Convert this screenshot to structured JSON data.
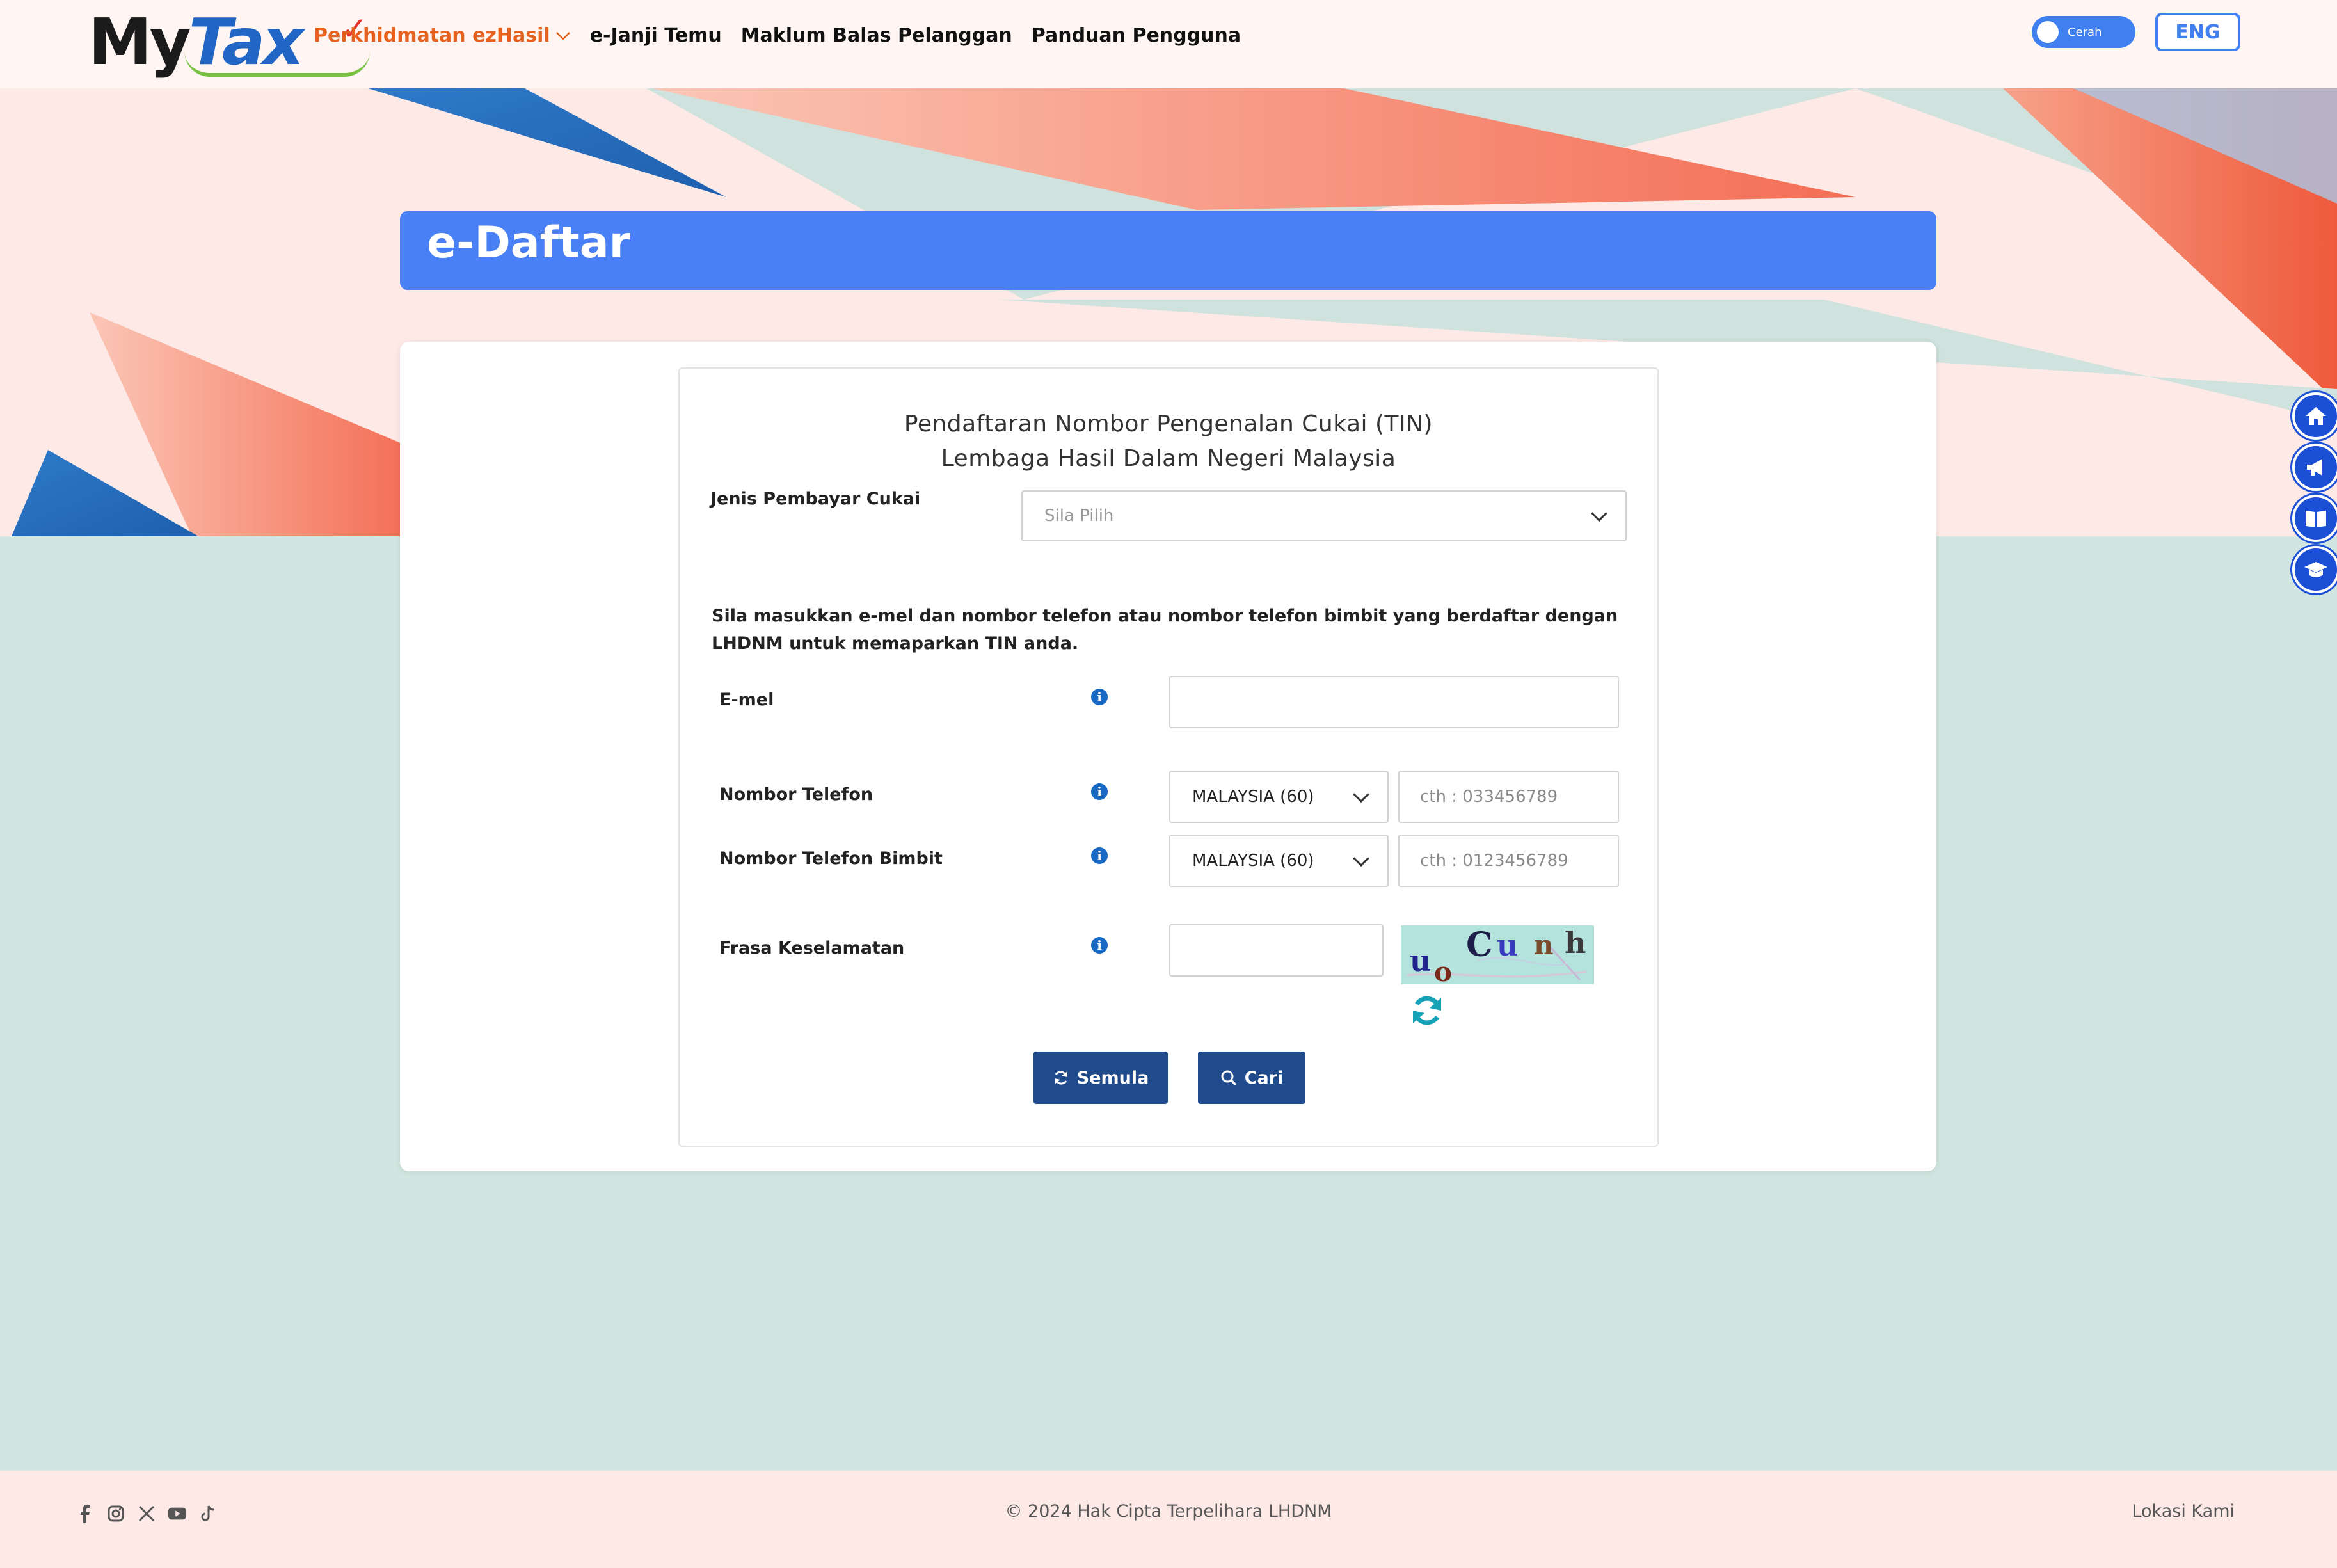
{
  "header": {
    "logo_my": "My",
    "logo_tax": "Tax",
    "nav": [
      {
        "label": "Perkhidmatan ezHasil",
        "active": true
      },
      {
        "label": "e-Janji Temu"
      },
      {
        "label": "Maklum Balas Pelanggan"
      },
      {
        "label": "Panduan Pengguna"
      }
    ],
    "theme_toggle_label": "Cerah",
    "language_button": "ENG"
  },
  "page": {
    "title": "e-Daftar"
  },
  "form": {
    "title_line1": "Pendaftaran Nombor Pengenalan Cukai (TIN)",
    "title_line2": "Lembaga Hasil Dalam Negeri Malaysia",
    "taxpayer_type_label": "Jenis Pembayar Cukai",
    "taxpayer_type_placeholder": "Sila Pilih",
    "instruction": "Sila masukkan e-mel dan nombor telefon atau nombor telefon bimbit yang berdaftar dengan LHDNM untuk memaparkan TIN anda.",
    "email_label": "E-mel",
    "email_value": "",
    "phone_label": "Nombor Telefon",
    "phone_country": "MALAYSIA (60)",
    "phone_placeholder": "cth : 033456789",
    "mobile_label": "Nombor Telefon Bimbit",
    "mobile_country": "MALAYSIA (60)",
    "mobile_placeholder": "cth : 0123456789",
    "captcha_label": "Frasa Keselamatan",
    "captcha_value": "",
    "captcha_chars": [
      "u",
      "o",
      "C",
      "u",
      "n",
      "h"
    ],
    "reset_button": "Semula",
    "search_button": "Cari"
  },
  "side_icons": [
    "home-icon",
    "megaphone-icon",
    "book-icon",
    "graduation-cap-icon"
  ],
  "footer": {
    "social_icons": [
      "facebook-icon",
      "instagram-icon",
      "x-icon",
      "youtube-icon",
      "tiktok-icon"
    ],
    "copyright": "© 2024 Hak Cipta Terpelihara LHDNM",
    "location_link": "Lokasi Kami"
  },
  "colors": {
    "primary_blue": "#4a80f5",
    "button_navy": "#1f4a8c",
    "nav_active": "#e5611d",
    "background_mint": "#d2e6e1",
    "footer_bg": "#fde9e5"
  }
}
